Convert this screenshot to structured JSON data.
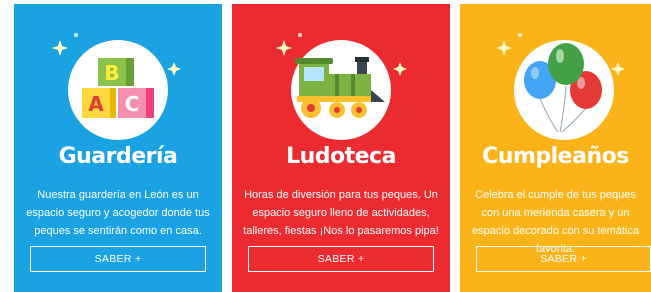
{
  "cards": [
    {
      "title": "Guardería",
      "description": "Nuestra guardería en León es un espacio seguro y acogedor donde tus peques se sentirán como en casa.",
      "button_label": "SABER +",
      "color": "#1aa2e3",
      "icon": "abc-blocks-icon"
    },
    {
      "title": "Ludoteca",
      "description": "Horas de diversión para tus peques. Un espacio seguro lleno de actividades, talleres, fiestas ¡Nos lo pasaremos pipa!",
      "button_label": "SABER +",
      "color": "#ec2b31",
      "icon": "toy-train-icon"
    },
    {
      "title": "Cumpleaños",
      "description": "Celebra el cumple de tus peques con una merienda casera y un espacio decorado con su temática favorita.",
      "button_label": "SABER +",
      "color": "#fab41a",
      "icon": "balloons-icon"
    }
  ]
}
